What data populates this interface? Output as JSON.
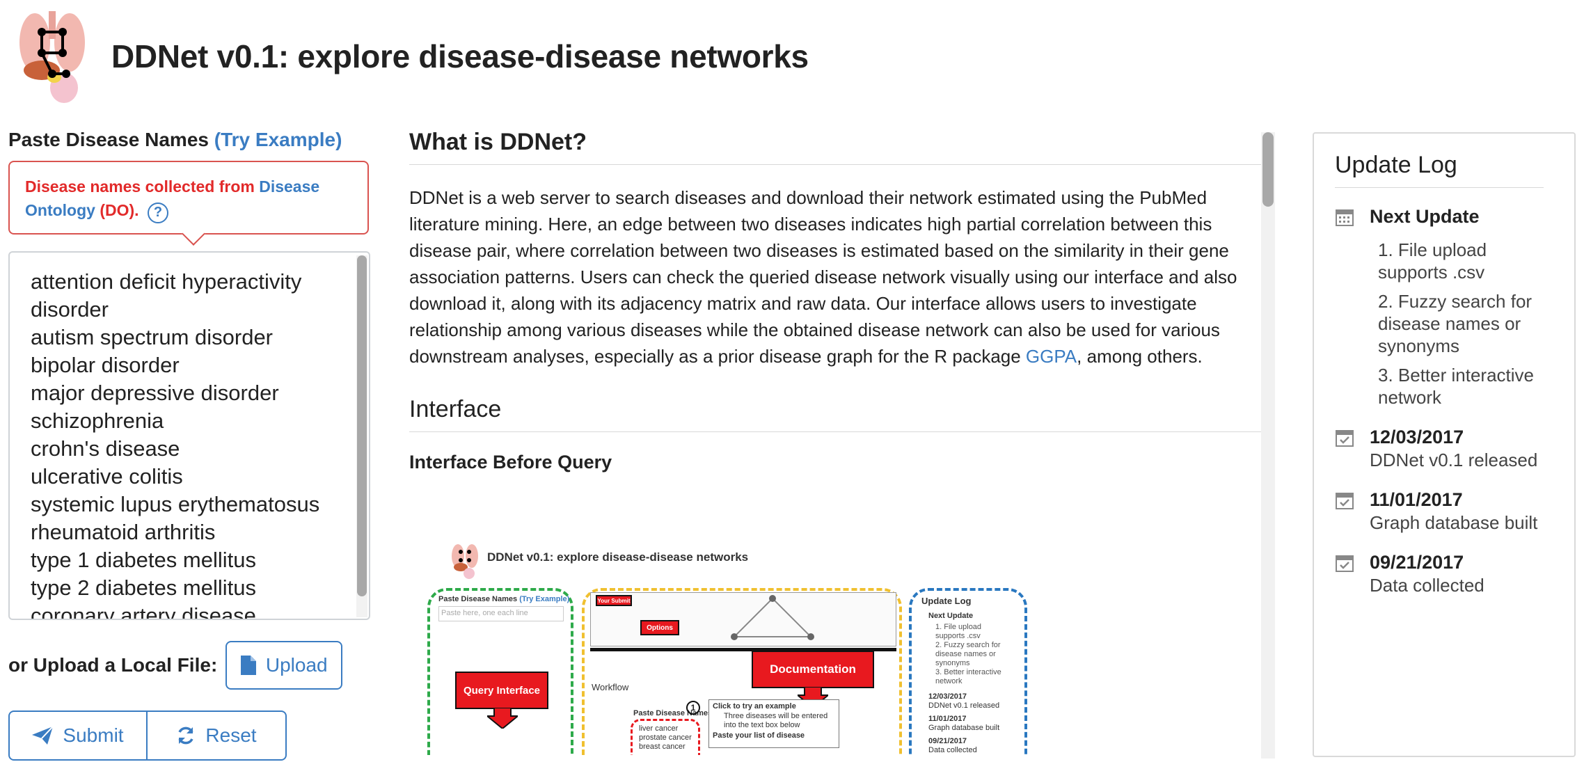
{
  "header": {
    "title": "DDNet v0.1: explore disease-disease networks"
  },
  "left": {
    "paste_label": "Paste Disease Names",
    "try_example": "(Try Example)",
    "callout_prefix": "Disease names collected from ",
    "callout_link1": "Disease",
    "callout_link2": "Ontology",
    "callout_suffix": " (DO).",
    "callout_help": "?",
    "diseases": [
      "attention deficit hyperactivity",
      "disorder",
      "autism spectrum disorder",
      "bipolar disorder",
      "major depressive disorder",
      "schizophrenia",
      "crohn's disease",
      "ulcerative colitis",
      "systemic lupus erythematosus",
      "rheumatoid arthritis",
      "type 1 diabetes mellitus",
      "type 2 diabetes mellitus",
      "coronary artery disease"
    ],
    "upload_label": "or Upload a Local File:",
    "upload_button": "Upload",
    "submit_button": "Submit",
    "reset_button": "Reset"
  },
  "middle": {
    "what_heading": "What is DDNet?",
    "para_main": "DDNet is a web server to search diseases and download their network estimated using the PubMed literature mining. Here, an edge between two diseases indicates high partial correlation between this disease pair, where correlation between two diseases is estimated based on the similarity in their gene association patterns. Users can check the queried disease network visually using our interface and also download it, along with its adjacency matrix and raw data. Our interface allows users to investigate relationship among various diseases while the obtained disease network can also be used for various downstream analyses, especially as a prior disease graph for the R package ",
    "para_link": "GGPA",
    "para_end": ", among others.",
    "interface_heading": "Interface",
    "before_query": "Interface Before Query",
    "thumb": {
      "title": "DDNet v0.1: explore disease-disease networks",
      "paste_label": "Paste Disease Names",
      "try_example": "(Try Example)",
      "placeholder": "Paste here, one each line",
      "query_box": "Query Interface",
      "doc_box": "Documentation",
      "your_submit": "Your Submit",
      "options": "Options",
      "workflow": "Workflow",
      "step1": "Click to try an example",
      "step1_bullet": "Three diseases will be entered into the text box below",
      "step2": "Paste your list of disease",
      "circle_one": "1",
      "list_items": [
        "liver cancer",
        "prostate cancer",
        "breast cancer"
      ],
      "log_title": "Update Log",
      "log_next": "Next Update",
      "log_items": [
        "1. File upload supports .csv",
        "2. Fuzzy search for disease names or synonyms",
        "3. Better interactive network"
      ],
      "log_dates": [
        {
          "date": "12/03/2017",
          "desc": "DDNet v0.1 released"
        },
        {
          "date": "11/01/2017",
          "desc": "Graph database built"
        },
        {
          "date": "09/21/2017",
          "desc": "Data collected"
        }
      ]
    }
  },
  "right": {
    "title": "Update Log",
    "next_update": "Next Update",
    "next_items": [
      "1. File upload supports .csv",
      "2. Fuzzy search for disease names or synonyms",
      "3. Better interactive network"
    ],
    "entries": [
      {
        "date": "12/03/2017",
        "desc": "DDNet v0.1 released"
      },
      {
        "date": "11/01/2017",
        "desc": "Graph database built"
      },
      {
        "date": "09/21/2017",
        "desc": "Data collected"
      }
    ]
  },
  "colors": {
    "accent": "#3a7cc2",
    "alert": "#e22a2a",
    "green_dash": "#2eaa4a",
    "yellow_dash": "#f0c030",
    "blue_dash": "#2a78c0"
  }
}
